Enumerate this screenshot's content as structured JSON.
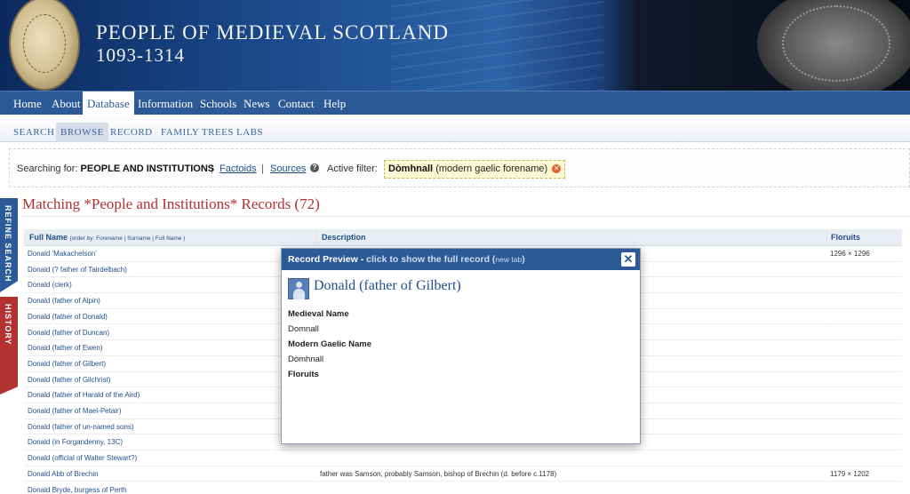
{
  "banner": {
    "title": "PEOPLE OF MEDIEVAL SCOTLAND",
    "subtitle": "1093-1314"
  },
  "main_nav": [
    "Home",
    "About",
    "Database",
    "Information",
    "Schools",
    "News",
    "Contact",
    "Help"
  ],
  "main_nav_active": "Database",
  "sub_nav": [
    "SEARCH",
    "BROWSE",
    "RECORD",
    "FAMILY TREES",
    "LABS"
  ],
  "sub_nav_active": "BROWSE",
  "search_bar": {
    "searching_for_label": "Searching for:",
    "searching_for_value": "PEOPLE AND INSTITUTIONS",
    "separator": "|",
    "factoids_link": "Factoids",
    "sources_link": "Sources",
    "help_icon": "?",
    "active_filter_label": "Active filter:",
    "filter_value": "Dòmhnall",
    "filter_note": "(modern gaelic forename)"
  },
  "side_tabs": {
    "refine": "REFINE SEARCH",
    "history": "HISTORY"
  },
  "heading": "Matching *People and Institutions* Records (72)",
  "table": {
    "col_fullname": "Full Name",
    "order_by": "(order by:",
    "order_forename": "Forename",
    "order_surname": "Surname",
    "order_fullname": "Full Name",
    "order_close": ")",
    "col_description": "Description",
    "col_floruits": "Floruits",
    "rows": [
      {
        "name": "Donald 'Makachelson'",
        "description": "",
        "floruit": "1296 × 1296"
      },
      {
        "name": "Donald (? father of Tairdelbach)",
        "description": "",
        "floruit": ""
      },
      {
        "name": "Donald (clerk)",
        "description": "",
        "floruit": ""
      },
      {
        "name": "Donald (father of Alpin)",
        "description": "",
        "floruit": ""
      },
      {
        "name": "Donald (father of Donald)",
        "description": "",
        "floruit": ""
      },
      {
        "name": "Donald (father of Duncan)",
        "description": "",
        "floruit": ""
      },
      {
        "name": "Donald (father of Ewen)",
        "description": "",
        "floruit": ""
      },
      {
        "name": "Donald (father of Gilbert)",
        "description": "",
        "floruit": ""
      },
      {
        "name": "Donald (father of Gilchrist)",
        "description": "",
        "floruit": ""
      },
      {
        "name": "Donald (father of Harald of the Aird)",
        "description": "",
        "floruit": ""
      },
      {
        "name": "Donald (father of Mael-Petair)",
        "description": "",
        "floruit": ""
      },
      {
        "name": "Donald (father of un-named sons)",
        "description": "",
        "floruit": ""
      },
      {
        "name": "Donald (in Forgandenny, 13C)",
        "description": "",
        "floruit": ""
      },
      {
        "name": "Donald (official of Walter Stewart?)",
        "description": "",
        "floruit": ""
      },
      {
        "name": "Donald Abb of Brechin",
        "description": "father was Samson, probably Samson, bishop of Brechin (d. before c.1178)",
        "floruit": "1179 × 1202"
      },
      {
        "name": "Donald Bryde, burgess of Perth",
        "description": "",
        "floruit": ""
      }
    ]
  },
  "popup": {
    "title_bold": "Record Preview -",
    "title_action": "click to show the full record",
    "title_tab_open": "(",
    "title_tab": "new tab",
    "title_tab_close": ")",
    "close_symbol": "✕",
    "name": "Donald (father of Gilbert)",
    "medieval_name_label": "Medieval Name",
    "medieval_name": "Domnall",
    "modern_gaelic_label": "Modern Gaelic Name",
    "modern_gaelic": "Dòmhnall",
    "floruits_label": "Floruits"
  },
  "colors": {
    "nav_blue": "#2b5a97",
    "heading_red": "#b23131",
    "link_blue": "#1f4f8b",
    "filter_bg": "#fdf7d4"
  }
}
